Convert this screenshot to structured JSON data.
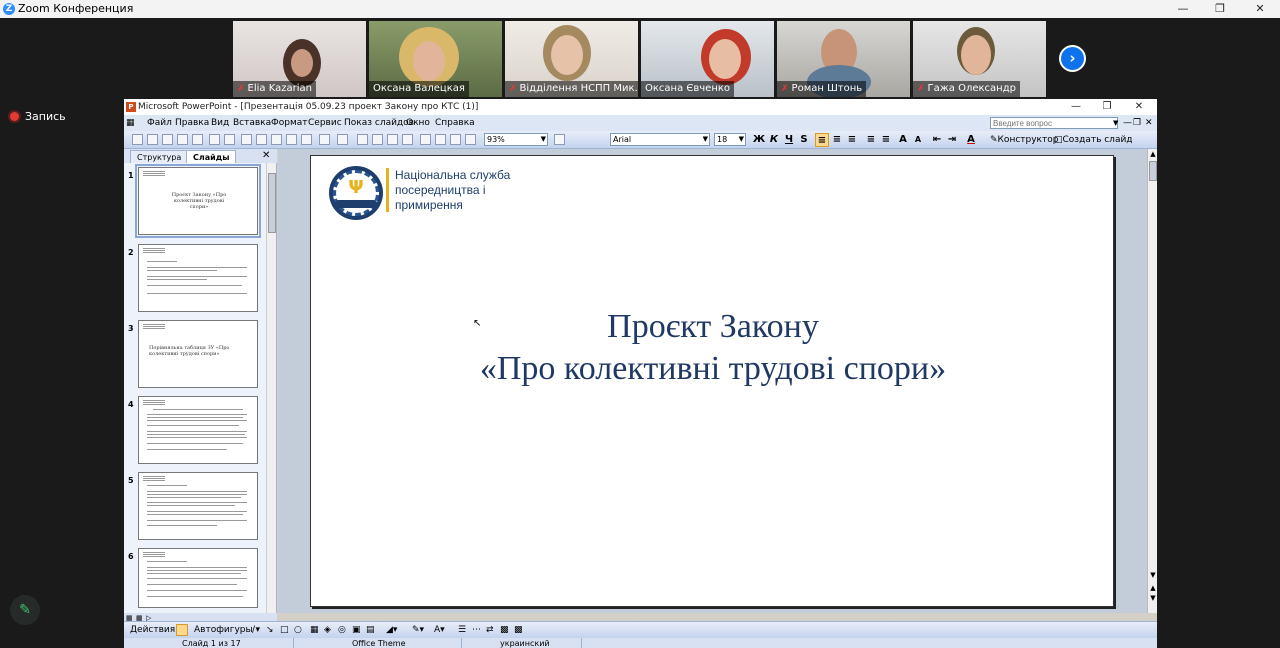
{
  "zoom": {
    "title": "Zoom Конференция",
    "record_label": "Запись",
    "participants": [
      {
        "name": "Elia Kazarian"
      },
      {
        "name": "Оксана Валецкая"
      },
      {
        "name": "Відділення НСПП Мик..."
      },
      {
        "name": "Оксана Євченко"
      },
      {
        "name": "Роман Штонь"
      },
      {
        "name": "Гажа Олександр"
      }
    ]
  },
  "ppt": {
    "title": "Microsoft PowerPoint - [Презентація 05.09.23 проект Закону про КТС (1)]",
    "menu": [
      "Файл",
      "Правка",
      "Вид",
      "Вставка",
      "Формат",
      "Сервис",
      "Показ слайдов",
      "Окно",
      "Справка"
    ],
    "ask_placeholder": "Введите вопрос",
    "zoom_value": "93%",
    "font_name": "Arial",
    "font_size": "18",
    "designer_label": "Конструктор",
    "new_slide_label": "Создать слайд",
    "panel_tabs": [
      "Структура",
      "Слайды"
    ],
    "slide_numbers": [
      "1",
      "2",
      "3",
      "4",
      "5",
      "6"
    ],
    "thumb1_text": "Проєкт Закону «Про колективні трудові спори»",
    "thumb3_text": "Порівняльна таблиця ЗУ «Про колективні трудові спори»",
    "slide": {
      "org_name": "Національна служба посередництва і примирення",
      "title_line1": "Проєкт Закону",
      "title_line2": "«Про колективні трудові спори»"
    },
    "drawbar": {
      "actions_label": "Действия",
      "autoshapes_label": "Автофигуры"
    },
    "status": {
      "slide_info": "Слайд 1 из 17",
      "theme": "Office Theme",
      "language": "украинский"
    },
    "colors": {
      "title_color": "#1f3864",
      "accent": "#1e3f6e",
      "gold": "#e8b21c"
    }
  }
}
